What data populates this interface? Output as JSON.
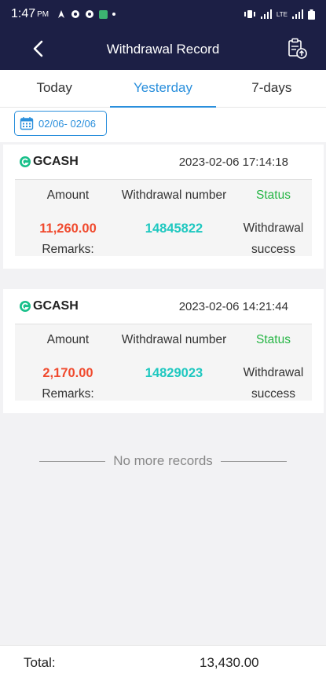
{
  "status_bar": {
    "time": "1:47",
    "ampm": "PM",
    "network": "LTE"
  },
  "header": {
    "title": "Withdrawal Record"
  },
  "tabs": [
    {
      "label": "Today",
      "active": false
    },
    {
      "label": "Yesterday",
      "active": true
    },
    {
      "label": "7-days",
      "active": false
    }
  ],
  "date_filter": {
    "range": "02/06- 02/06"
  },
  "columns": {
    "amount": "Amount",
    "withdrawal_number": "Withdrawal number",
    "status": "Status",
    "remarks": "Remarks:"
  },
  "records": [
    {
      "method": "GCASH",
      "datetime": "2023-02-06 17:14:18",
      "amount": "11,260.00",
      "withdrawal_number": "14845822",
      "status_line1": "Withdrawal",
      "status_line2": "success"
    },
    {
      "method": "GCASH",
      "datetime": "2023-02-06 14:21:44",
      "amount": "2,170.00",
      "withdrawal_number": "14829023",
      "status_line1": "Withdrawal",
      "status_line2": "success"
    }
  ],
  "no_more_text": "No more records",
  "footer": {
    "total_label": "Total:",
    "total_value": "13,430.00"
  },
  "colors": {
    "header_bg": "#1c1f45",
    "accent": "#2a8fdc",
    "amount": "#f04a2e",
    "number": "#1fc8c0",
    "status": "#25b544"
  }
}
